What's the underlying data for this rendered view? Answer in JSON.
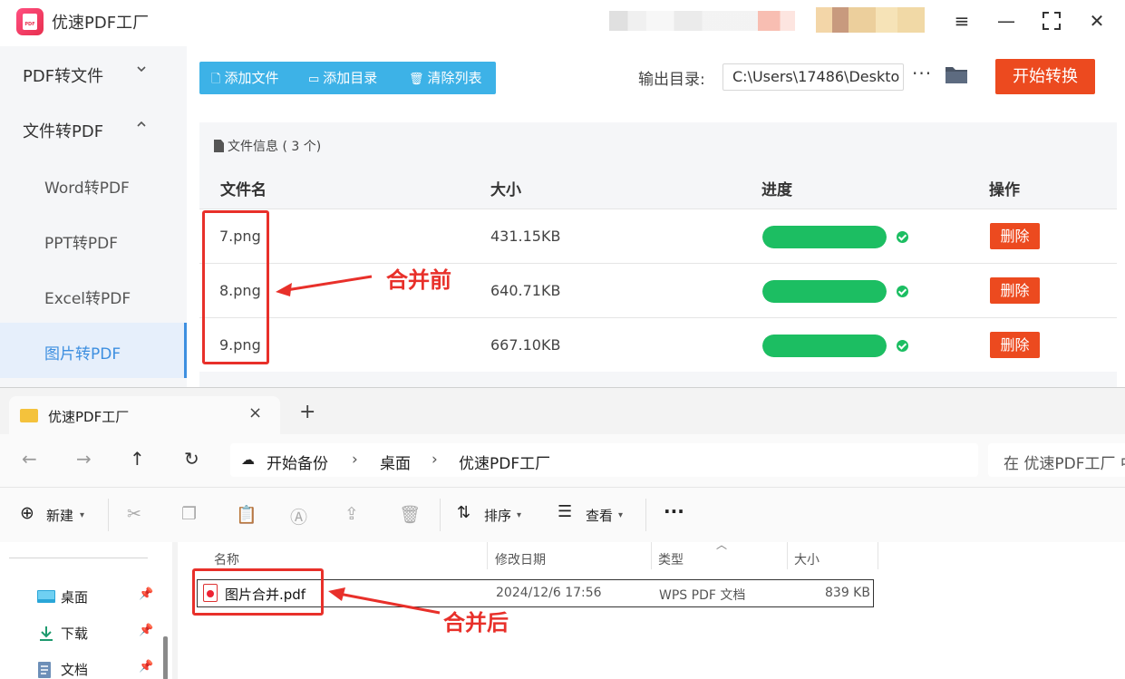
{
  "app": {
    "title": "优速PDF工厂",
    "window_controls": [
      "menu-icon",
      "minimize-icon",
      "maximize-icon",
      "close-icon"
    ]
  },
  "sidebar": {
    "groups": [
      {
        "label": "PDF转文件",
        "expanded": false
      },
      {
        "label": "文件转PDF",
        "expanded": true
      }
    ],
    "items": [
      {
        "label": "Word转PDF"
      },
      {
        "label": "PPT转PDF"
      },
      {
        "label": "Excel转PDF"
      },
      {
        "label": "图片转PDF",
        "active": true
      }
    ]
  },
  "toolbar": {
    "add_file": "添加文件",
    "add_dir": "添加目录",
    "clear_list": "清除列表",
    "output_label": "输出目录:",
    "output_path": "C:\\Users\\17486\\Deskto",
    "more": "···",
    "start": "开始转换"
  },
  "file_panel": {
    "info_label": "文件信息",
    "info_count": "( 3 个)",
    "columns": {
      "name": "文件名",
      "size": "大小",
      "progress": "进度",
      "action": "操作"
    },
    "rows": [
      {
        "name": "7.png",
        "size": "431.15KB",
        "progress": 1.0,
        "action": "删除"
      },
      {
        "name": "8.png",
        "size": "640.71KB",
        "progress": 1.0,
        "action": "删除"
      },
      {
        "name": "9.png",
        "size": "667.10KB",
        "progress": 1.0,
        "action": "删除"
      }
    ]
  },
  "explorer": {
    "tab_title": "优速PDF工厂",
    "tab_close": "×",
    "tab_new": "+",
    "breadcrumb": [
      "开始备份",
      "桌面",
      "优速PDF工厂"
    ],
    "search_placeholder": "在 优速PDF工厂 中",
    "commands": {
      "new": "新建",
      "sort": "排序",
      "view": "查看",
      "more": "···"
    },
    "nav": [
      {
        "label": "桌面",
        "icon": "desktop-icon"
      },
      {
        "label": "下载",
        "icon": "download-icon"
      },
      {
        "label": "文档",
        "icon": "document-icon"
      }
    ],
    "columns": {
      "name": "名称",
      "date": "修改日期",
      "type": "类型",
      "size": "大小"
    },
    "files": [
      {
        "name": "图片合并.pdf",
        "date": "2024/12/6 17:56",
        "type": "WPS PDF 文档",
        "size": "839 KB"
      }
    ]
  },
  "annotations": {
    "before": "合并前",
    "after": "合并后",
    "color": "#e8302a"
  },
  "colors": {
    "accent_blue": "#3db2e7",
    "primary_red": "#ec4a1f",
    "progress_green": "#1cbe62"
  }
}
